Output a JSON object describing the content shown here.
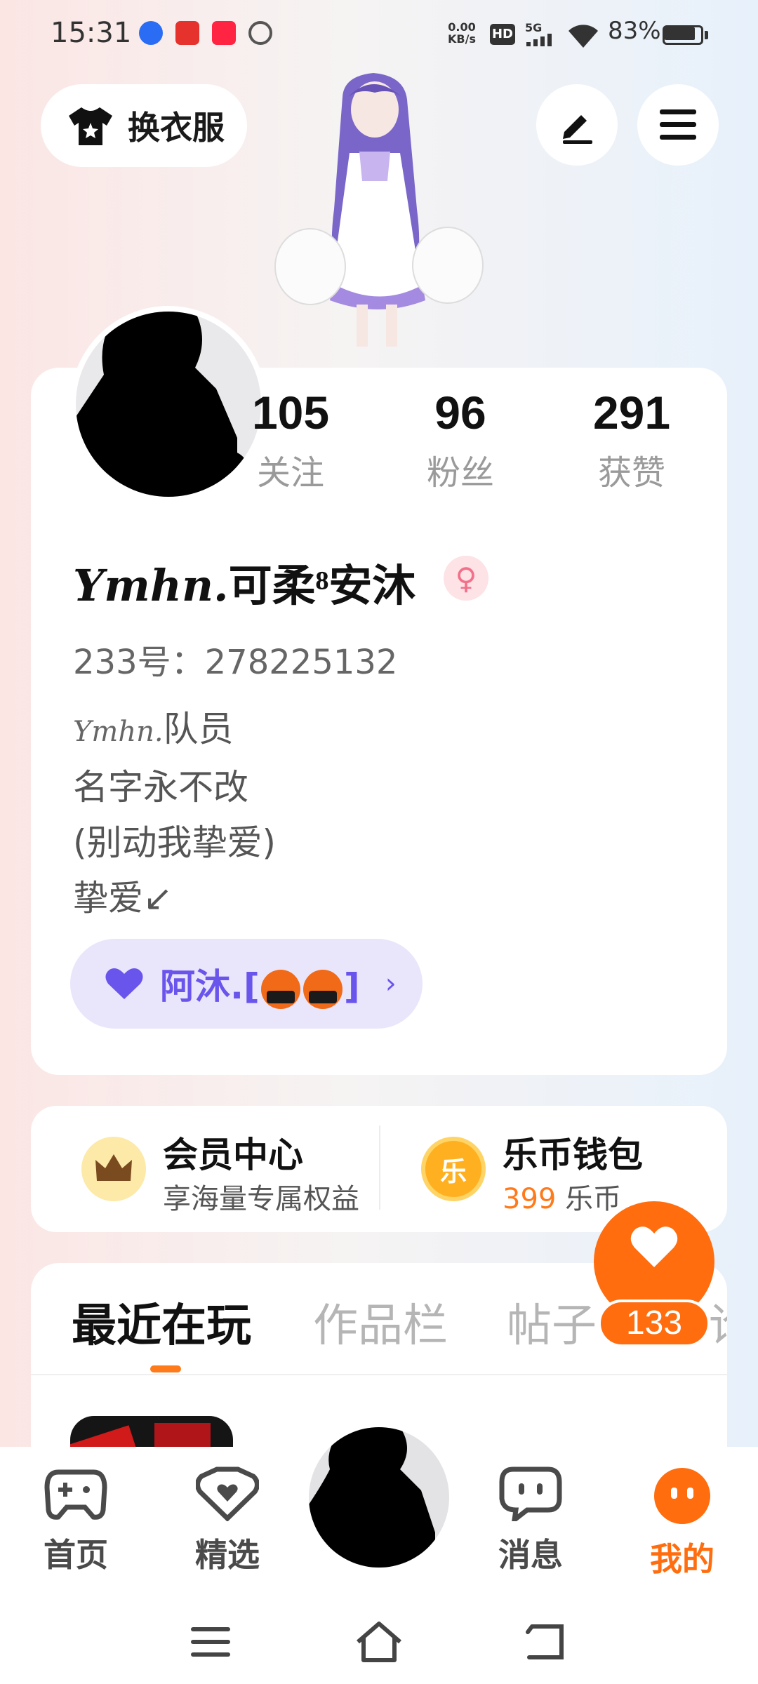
{
  "status_bar": {
    "time": "15:31",
    "net_speed_value": "0.00",
    "net_speed_unit": "KB/s",
    "hd": "HD",
    "network": "5G",
    "battery_pct": "83%",
    "battery_level": 0.83
  },
  "top_bar": {
    "change_clothes_label": "换衣服",
    "edit_icon": "pen-icon",
    "menu_icon": "hamburger-icon"
  },
  "profile": {
    "stats": [
      {
        "num": "105",
        "label": "关注"
      },
      {
        "num": "96",
        "label": "粉丝"
      },
      {
        "num": "291",
        "label": "获赞"
      }
    ],
    "name_script": "Ymhn.",
    "name_main": "可柔⁸安沐",
    "gender_symbol": "♀",
    "uid": "233号：278225132",
    "bio_script": "Ymhn.",
    "bio_line1_suffix": "队员",
    "bio_line2": "名字永不改",
    "bio_line3": "(别动我挚爱)",
    "bio_line4": "挚爱↙",
    "tag_text_before": "阿沐.[",
    "tag_text_after": "]"
  },
  "member_center": {
    "title": "会员中心",
    "subtitle": "享海量专属权益"
  },
  "wallet": {
    "title": "乐币钱包",
    "coin_char": "乐",
    "amount": "399",
    "unit": " 乐币"
  },
  "tabs": [
    "最近在玩",
    "作品栏",
    "帖子",
    "论"
  ],
  "like_fab": {
    "count": "133"
  },
  "bottom_nav": {
    "home": "首页",
    "featured": "精选",
    "messages": "消息",
    "mine": "我的"
  },
  "colors": {
    "accent": "#ff6d0e",
    "tag_purple": "#6a55ec"
  }
}
